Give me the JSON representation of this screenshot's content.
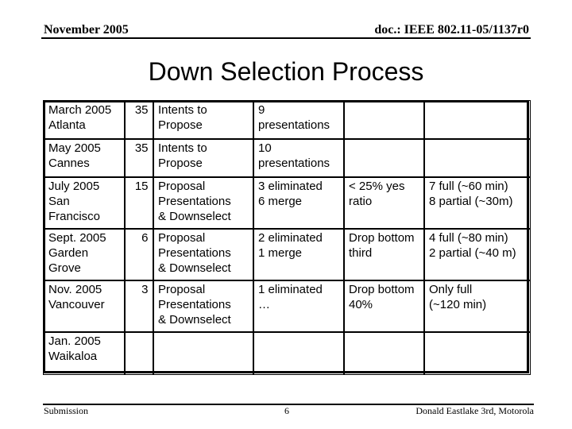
{
  "header": {
    "date": "November 2005",
    "doc": "doc.: IEEE 802.11-05/1137r0"
  },
  "title": "Down Selection Process",
  "table": {
    "rows": [
      [
        "March 2005\nAtlanta",
        "35",
        "Intents to\nPropose",
        "9\npresentations",
        "",
        ""
      ],
      [
        "May 2005\nCannes",
        "35",
        "Intents to\nPropose",
        "10\npresentations",
        "",
        ""
      ],
      [
        "July 2005\nSan\nFrancisco",
        "15",
        "Proposal\nPresentations\n& Downselect",
        "3 eliminated\n6 merge",
        "< 25% yes\nratio",
        "7 full (~60 min)\n8 partial (~30m)"
      ],
      [
        "Sept. 2005\nGarden\nGrove",
        "6",
        "Proposal\nPresentations\n& Downselect",
        "2 eliminated\n1 merge",
        "Drop bottom\nthird",
        "4 full (~80 min)\n2 partial (~40 m)"
      ],
      [
        "Nov. 2005\nVancouver",
        "3",
        "Proposal\nPresentations\n& Downselect",
        "1 eliminated\n…",
        "Drop bottom\n40%",
        "Only full\n(~120 min)"
      ],
      [
        "Jan. 2005\nWaikaloa",
        "",
        "",
        "",
        "",
        ""
      ]
    ]
  },
  "footer": {
    "left": "Submission",
    "page": "6",
    "author": "Donald Eastlake 3rd, Motorola"
  }
}
